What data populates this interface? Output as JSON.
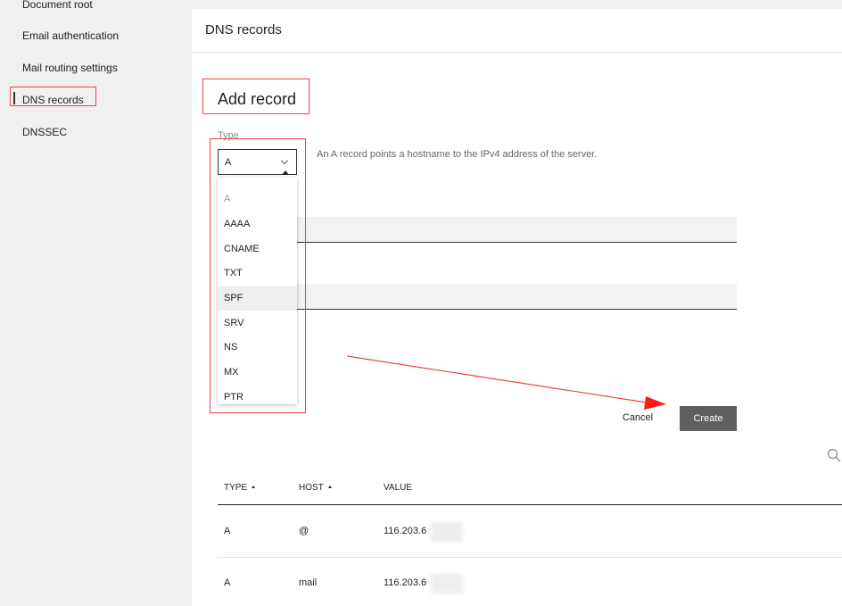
{
  "sidebar": {
    "items": [
      {
        "label": "Document root"
      },
      {
        "label": "Email authentication"
      },
      {
        "label": "Mail routing settings"
      },
      {
        "label": "DNS records"
      },
      {
        "label": "DNSSEC"
      }
    ],
    "active": "DNS records"
  },
  "header": {
    "title": "DNS records"
  },
  "form": {
    "title": "Add record",
    "type_label": "Type",
    "type_value": "A",
    "type_description": "An A record points a hostname to the IPv4 address of the server.",
    "type_options": [
      "A",
      "AAAA",
      "CNAME",
      "TXT",
      "SPF",
      "SRV",
      "NS",
      "MX",
      "PTR"
    ],
    "hovered_option": "SPF",
    "cancel_label": "Cancel",
    "create_label": "Create"
  },
  "table": {
    "columns": [
      {
        "label": "TYPE"
      },
      {
        "label": "HOST"
      },
      {
        "label": "VALUE"
      }
    ],
    "rows": [
      {
        "type": "A",
        "host": "@",
        "value": "116.203.6"
      },
      {
        "type": "A",
        "host": "mail",
        "value": "116.203.6"
      }
    ]
  },
  "colors": {
    "annotation_red": "#e8454a",
    "create_button_bg": "#5f5f5f"
  },
  "icons": {
    "search": "search-icon",
    "select_chevron": "chevron-down-icon"
  }
}
